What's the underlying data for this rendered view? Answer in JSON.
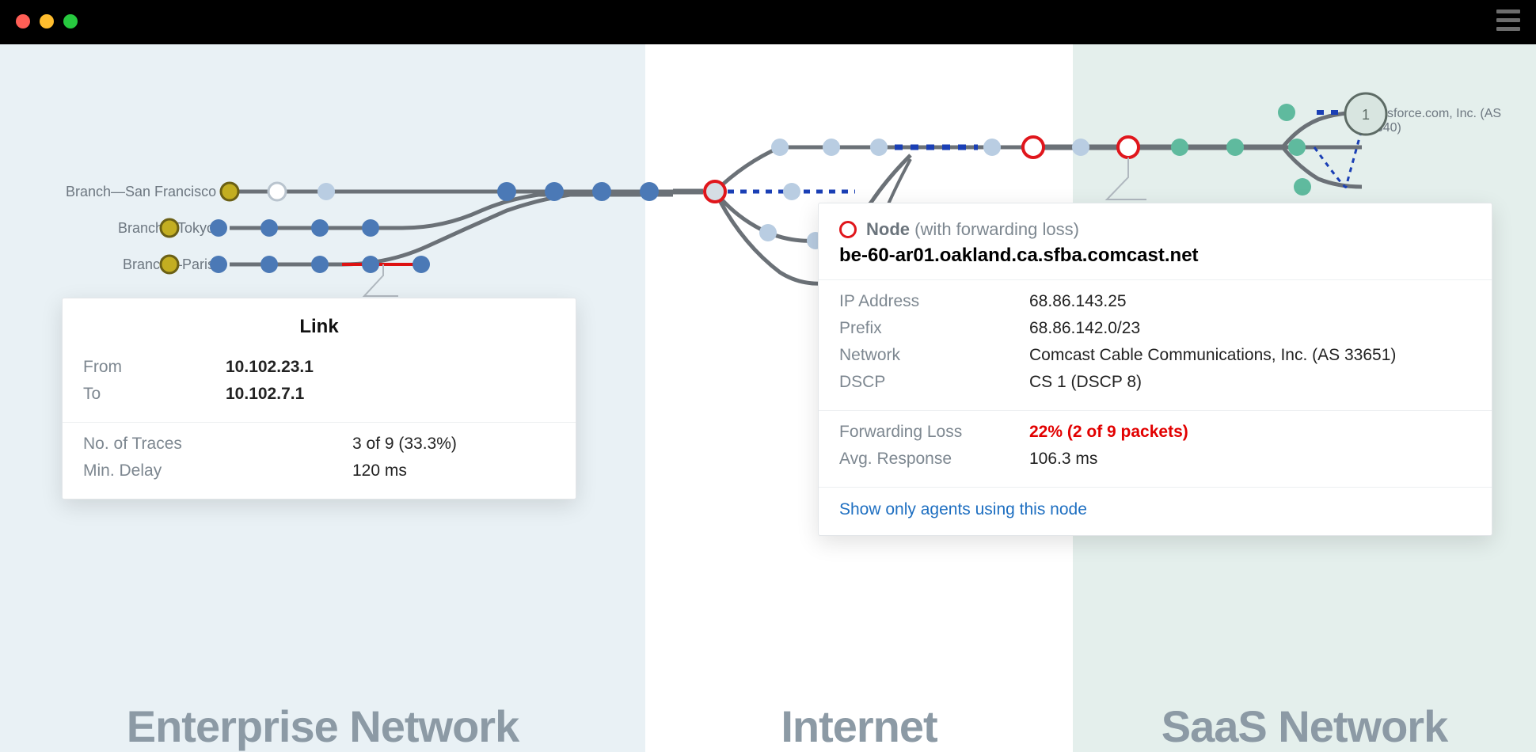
{
  "sections": {
    "enterprise": "Enterprise Network",
    "internet": "Internet",
    "saas": "SaaS Network"
  },
  "branches": [
    "Branch—San Francisco",
    "Branch—Tokyo",
    "Branch—Paris"
  ],
  "destination": {
    "badge": "1",
    "label": "Salesforce.com, Inc. (AS 14340)"
  },
  "link_popover": {
    "title": "Link",
    "from_label": "From",
    "from": "10.102.23.1",
    "to_label": "To",
    "to": "10.102.7.1",
    "traces_label": "No. of Traces",
    "traces": "3 of 9 (33.3%)",
    "delay_label": "Min. Delay",
    "delay": "120 ms"
  },
  "node_popover": {
    "header_strong": "Node",
    "header_rest": "(with forwarding loss)",
    "hostname": "be-60-ar01.oakland.ca.sfba.comcast.net",
    "rows": [
      {
        "k": "IP Address",
        "v": "68.86.143.25"
      },
      {
        "k": "Prefix",
        "v": "68.86.142.0/23"
      },
      {
        "k": "Network",
        "v": "Comcast Cable Communications, Inc. (AS 33651)"
      },
      {
        "k": "DSCP",
        "v": "CS 1 (DSCP 8)"
      }
    ],
    "loss_label": "Forwarding Loss",
    "loss": "22% (2 of 9 packets)",
    "resp_label": "Avg. Response",
    "resp": "106.3 ms",
    "action": "Show only agents using this node"
  }
}
